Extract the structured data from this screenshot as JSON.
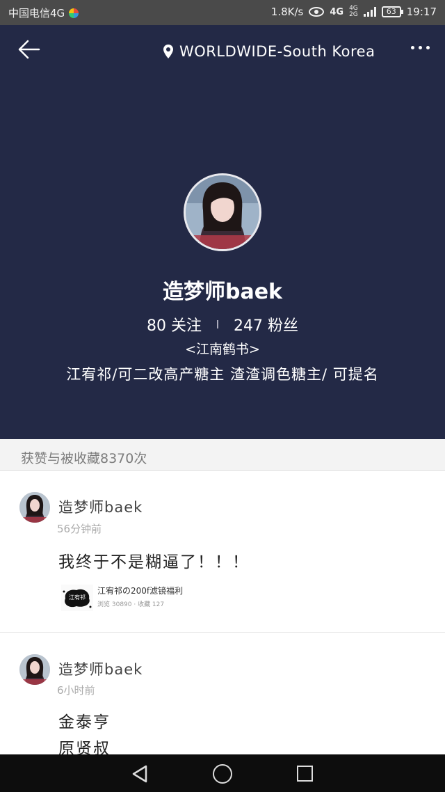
{
  "status_bar": {
    "carrier": "中国电信4G",
    "speed": "1.8K/s",
    "network_main": "4G",
    "network_sub_top": "4G",
    "network_sub_bottom": "2G",
    "battery": "63",
    "time": "19:17"
  },
  "header": {
    "location": "WORLDWIDE-South Korea",
    "username": "造梦师baek",
    "following_count": "80 关注",
    "follower_count": "247 粉丝",
    "bio_line1": "<江南鹤书>",
    "bio_line2": "江宥祁/可二改高产糖主 渣渣调色糖主/ 可提名",
    "background_color": "#232946"
  },
  "likes_bar": {
    "text": "获赞与被收藏8370次"
  },
  "posts": [
    {
      "author": "造梦师baek",
      "time": "56分钟前",
      "lines": [
        "我终于不是糊逼了！！！"
      ],
      "link": {
        "thumb_text": "江宥祁",
        "title": "江宥祁の200f滤镜福利",
        "meta": "浏览 30890 · 收藏 127"
      }
    },
    {
      "author": "造梦师baek",
      "time": "6小时前",
      "lines": [
        "金泰亨",
        "原贤叔"
      ]
    }
  ],
  "icons": {
    "back": "arrow-left-icon",
    "location": "pin-icon",
    "more": "more-dots-icon",
    "nav_back": "triangle-back-icon",
    "nav_home": "circle-home-icon",
    "nav_recent": "square-recent-icon"
  }
}
